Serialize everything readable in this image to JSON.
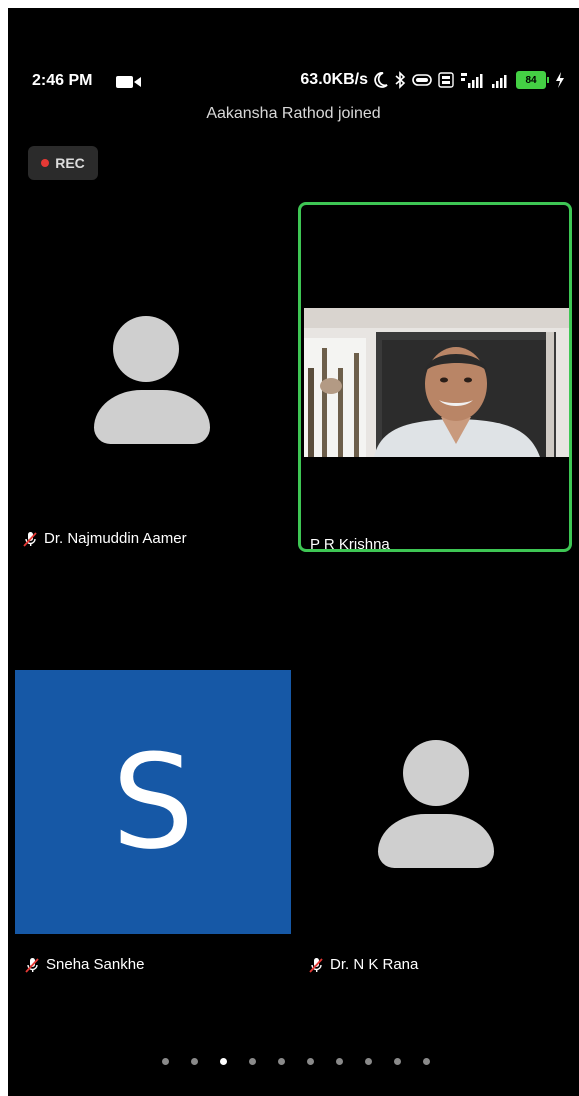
{
  "status_bar": {
    "time": "2:46 PM",
    "net_speed": "63.0KB/s",
    "battery": "84",
    "icons": [
      "video-recording-icon",
      "moon-icon",
      "bluetooth-icon",
      "wifi-toggle-icon",
      "volte-icon",
      "signal-4g-icon",
      "signal-icon",
      "battery-icon",
      "charging-bolt-icon"
    ]
  },
  "notification": "Aakansha Rathod joined",
  "recording": {
    "label": "REC",
    "dot_color": "#e53935"
  },
  "participants": [
    {
      "name": "Dr. Najmuddin Aamer",
      "muted": true,
      "video": false
    },
    {
      "name": "P R Krishna",
      "muted": false,
      "video": true,
      "active_speaker": true
    },
    {
      "name": "Sneha Sankhe",
      "muted": true,
      "video": false,
      "initial": "S",
      "tile_color": "#1658a6"
    },
    {
      "name": "Dr. N K Rana",
      "muted": true,
      "video": false
    }
  ],
  "pagination": {
    "pages": 10,
    "current": 3
  },
  "colors": {
    "active_border": "#3ec654",
    "background": "#000000",
    "avatar": "#cfcfcf"
  }
}
